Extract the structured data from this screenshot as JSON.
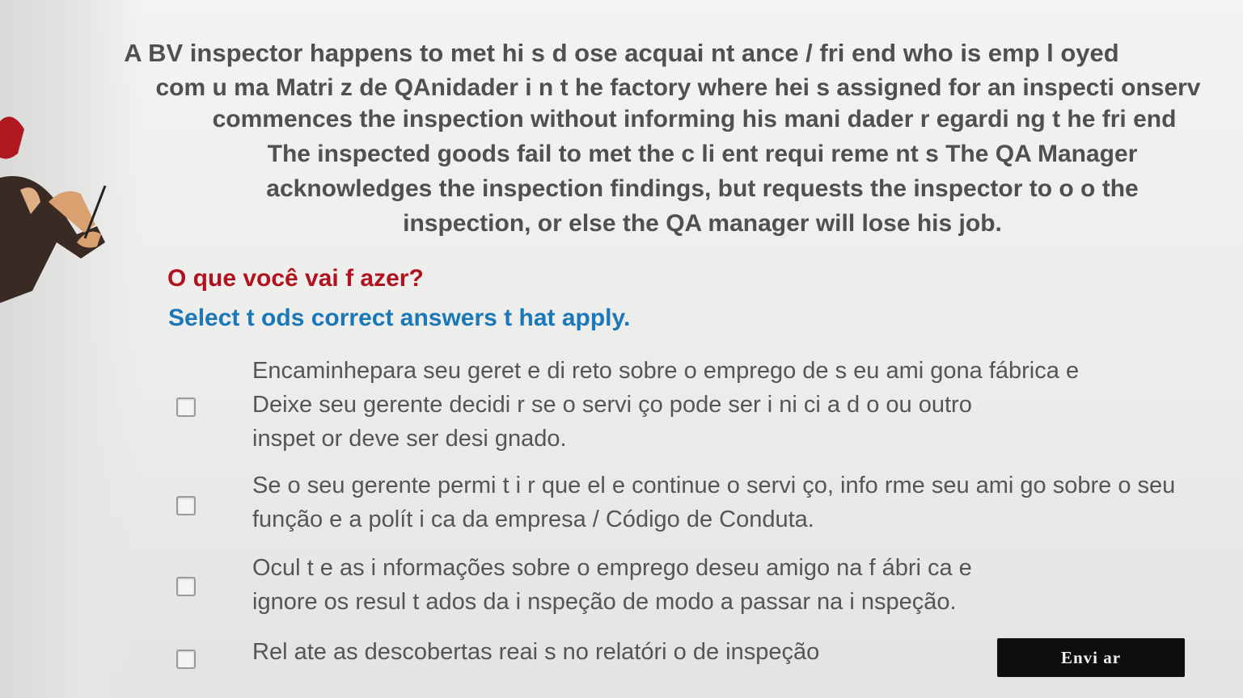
{
  "question": {
    "lines": [
      "A BV inspector happens to met hi s d ose acquai nt ance / fri end who is emp l oyed",
      "com u ma Matri z de QAnidader i n t he factory where hei s assigned for an inspecti onserv",
      "commences the inspection without informing his mani dader r egardi ng t he fri end",
      "The inspected goods fail to met the c li ent requi reme nt s The QA Manager",
      "acknowledges the inspection findings, but requests the inspector to o o the",
      "inspection, or else the QA manager will lose his job."
    ]
  },
  "prompt": "O que você vai f azer?",
  "instruction": "Select t ods correct answers t hat apply.",
  "options": [
    {
      "lines": [
        "Encaminhepara seu geret e di reto sobre o emprego de s eu ami gona fábrica e",
        "Deixe seu gerente decidi r se o servi ço pode ser i ni ci a d o ou outro",
        "inspet or deve ser desi gnado."
      ],
      "checked": false
    },
    {
      "lines": [
        "Se o seu gerente permi t i r que el e continue o servi ço, info rme seu ami go sobre o seu",
        "função e a polít i ca da empresa / Código de Conduta."
      ],
      "checked": false
    },
    {
      "lines": [
        "Ocul t e as i nformações sobre o emprego deseu amigo na f ábri ca e",
        "ignore os resul t ados da i nspeção de modo a passar na i nspeção."
      ],
      "checked": false
    },
    {
      "lines": [
        "Rel ate as descobertas reai s no relatóri o de inspeção"
      ],
      "checked": false
    }
  ],
  "submit_label": "Envi ar"
}
